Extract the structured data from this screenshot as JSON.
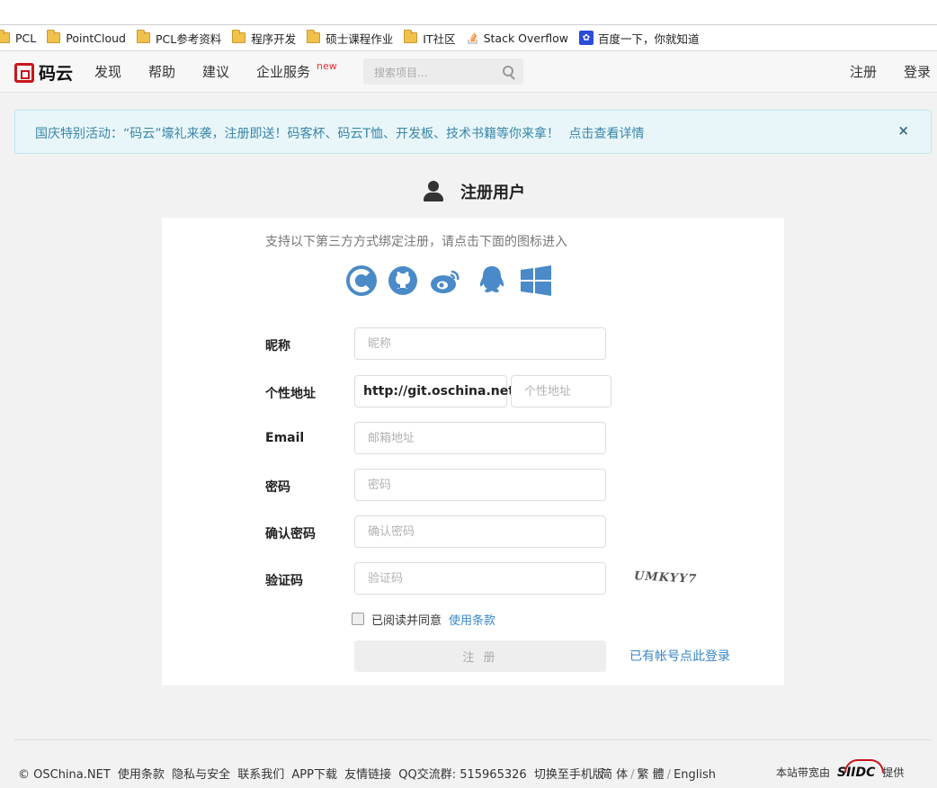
{
  "bookmarks": [
    {
      "label": "PCL",
      "icon": "folder-icon"
    },
    {
      "label": "PointCloud",
      "icon": "folder-icon"
    },
    {
      "label": "PCL参考资料",
      "icon": "folder-icon"
    },
    {
      "label": "程序开发",
      "icon": "folder-icon"
    },
    {
      "label": "硕士课程作业",
      "icon": "folder-icon"
    },
    {
      "label": "IT社区",
      "icon": "folder-icon"
    },
    {
      "label": "Stack Overflow",
      "icon": "stackoverflow-icon"
    },
    {
      "label": "百度一下，你就知道",
      "icon": "baidu-paw-icon"
    }
  ],
  "nav": {
    "logo_text": "码云",
    "links": [
      "发现",
      "帮助",
      "建议",
      "企业服务"
    ],
    "new_badge": "new",
    "search_placeholder": "搜索项目...",
    "register": "注册",
    "login": "登录"
  },
  "alert": {
    "text": "国庆特别活动：“码云”壕礼来袭，注册即送！码客杯、码云T恤、开发板、技术书籍等你来拿！",
    "link": "点击查看详情",
    "close": "×"
  },
  "form": {
    "title": "注册用户",
    "third_party_text": "支持以下第三方方式绑定注册，请点击下面的图标进入",
    "oauth_icons": [
      "csdn-icon",
      "github-icon",
      "weibo-icon",
      "qq-icon",
      "windows-icon"
    ],
    "nickname_label": "昵称",
    "nickname_placeholder": "昵称",
    "url_label": "个性地址",
    "url_prefix": "http://git.oschina.net",
    "url_placeholder": "个性地址",
    "email_label": "Email",
    "email_placeholder": "邮箱地址",
    "password_label": "密码",
    "password_placeholder": "密码",
    "confirm_label": "确认密码",
    "confirm_placeholder": "确认密码",
    "captcha_label": "验证码",
    "captcha_placeholder": "验证码",
    "captcha_text": "UMKYY7",
    "agree_text": "已阅读并同意",
    "terms_link": "使用条款",
    "submit": "注 册",
    "login_link": "已有帐号点此登录"
  },
  "footer": {
    "copyright": "© OSChina.NET",
    "links": [
      "使用条款",
      "隐私与安全",
      "联系我们",
      "APP下载",
      "友情链接",
      "QQ交流群: 515965326",
      "切换至手机版"
    ],
    "lang_simplified": "简 体",
    "lang_traditional": "繁 體",
    "lang_english": "English",
    "bandwidth_text": "本站带宽由",
    "bandwidth_logo": "SIIDC",
    "provide_text": "提供"
  },
  "colors": {
    "brand_red": "#c8161d",
    "link_blue": "#3a86c8",
    "oauth_blue": "#4a8ac8",
    "alert_bg": "#e8f6fa"
  }
}
